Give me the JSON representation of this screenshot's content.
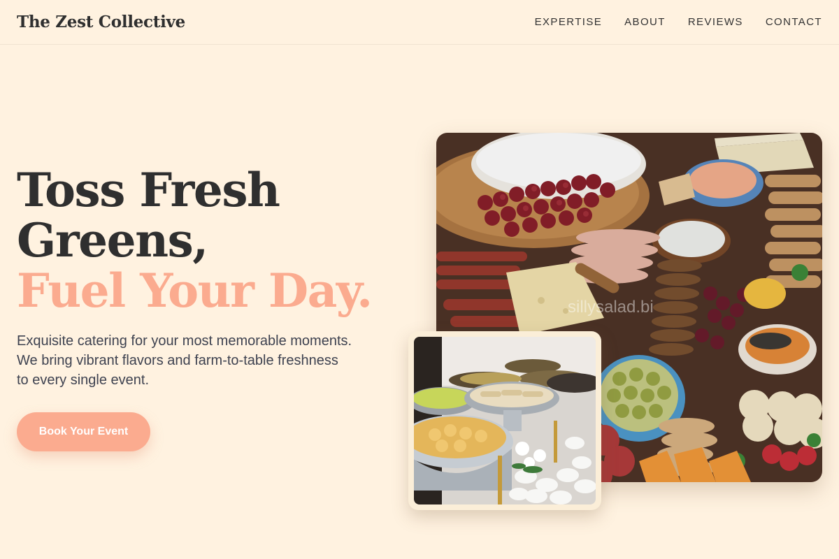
{
  "header": {
    "brand": "The Zest Collective",
    "nav": [
      "EXPERTISE",
      "ABOUT",
      "REVIEWS",
      "CONTACT"
    ]
  },
  "hero": {
    "headline_line1": "Toss Fresh",
    "headline_line2": "Greens,",
    "headline_accent": "Fuel Your Day.",
    "tagline_lines": [
      "Exquisite catering for your most memorable moments.",
      "We bring vibrant flavors and farm-to-table freshness",
      "to every single event."
    ],
    "cta_label": "Book Your Event"
  },
  "images": {
    "main": "charcuterie-board-photo",
    "main_watermark": "sillysalad.bi",
    "inset": "buffet-chafing-dishes-photo"
  },
  "colors": {
    "background": "#fff2e0",
    "accent": "#fbab8f",
    "text": "#2f2f2f"
  }
}
